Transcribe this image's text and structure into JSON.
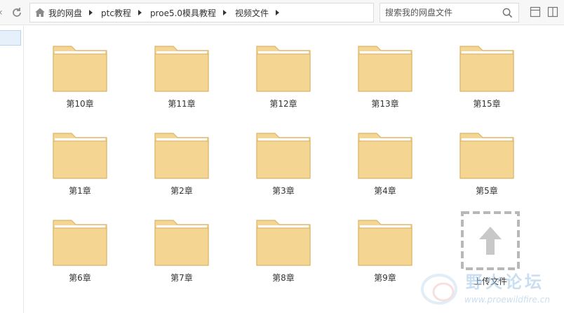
{
  "toolbar": {
    "back_icon": "chevron-left-icon",
    "refresh_icon": "refresh-icon",
    "breadcrumb": [
      "我的网盘",
      "ptc教程",
      "proe5.0模具教程",
      "视频文件"
    ],
    "search_placeholder": "搜索我的网盘文件"
  },
  "folders": [
    {
      "name": "第10章"
    },
    {
      "name": "第11章"
    },
    {
      "name": "第12章"
    },
    {
      "name": "第13章"
    },
    {
      "name": "第15章"
    },
    {
      "name": "第1章"
    },
    {
      "name": "第2章"
    },
    {
      "name": "第3章"
    },
    {
      "name": "第4章"
    },
    {
      "name": "第5章"
    },
    {
      "name": "第6章"
    },
    {
      "name": "第7章"
    },
    {
      "name": "第8章"
    },
    {
      "name": "第9章"
    }
  ],
  "upload": {
    "label": "上传文件"
  },
  "watermark": {
    "title": "野火论坛",
    "url": "www.proewildfire.cn"
  },
  "colors": {
    "folder_fill": "#f5d592",
    "folder_stroke": "#dcb56a",
    "accent": "#e5f0fb"
  }
}
